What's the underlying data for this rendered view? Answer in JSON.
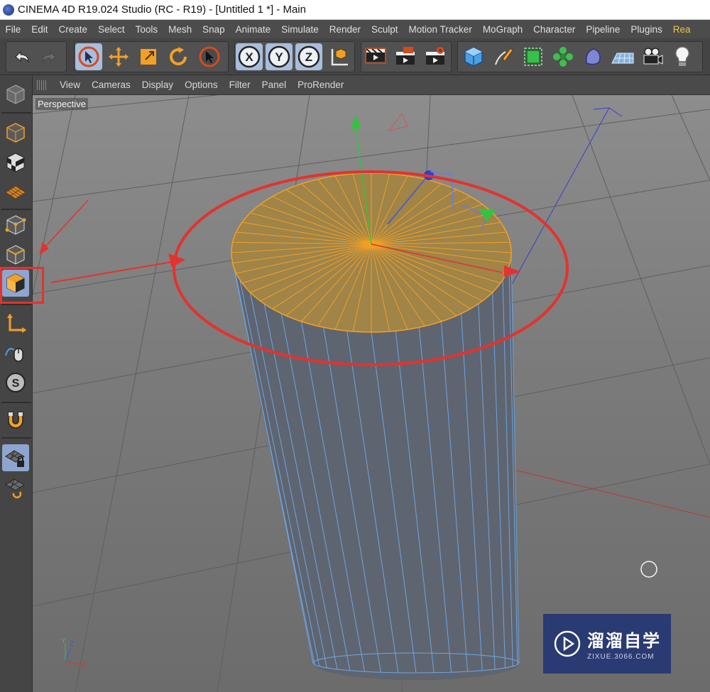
{
  "window": {
    "title": "CINEMA 4D R19.024 Studio (RC - R19) - [Untitled 1 *] - Main"
  },
  "menu": [
    "File",
    "Edit",
    "Create",
    "Select",
    "Tools",
    "Mesh",
    "Snap",
    "Animate",
    "Simulate",
    "Render",
    "Sculpt",
    "Motion Tracker",
    "MoGraph",
    "Character",
    "Pipeline",
    "Plugins",
    "Rea"
  ],
  "toolbar": {
    "icons": [
      "undo-icon",
      "redo-icon",
      "live-selection-icon",
      "move-icon",
      "scale-icon",
      "rotate-icon",
      "recent-tool-icon",
      "x-axis-lock-icon",
      "y-axis-lock-icon",
      "z-axis-lock-icon",
      "coordinate-system-icon",
      "render-view-icon",
      "render-picture-viewer-icon",
      "edit-render-settings-icon",
      "cube-primitive-icon",
      "pen-spline-icon",
      "subdivision-surface-icon",
      "cloner-icon",
      "deformer-icon",
      "floor-icon",
      "camera-icon",
      "light-icon"
    ],
    "axis_labels": {
      "x": "X",
      "y": "Y",
      "z": "Z"
    }
  },
  "left_palette": {
    "icons": [
      "make-editable-icon",
      "model-mode-icon",
      "texture-mode-icon",
      "workplane-mode-icon",
      "points-mode-icon",
      "edges-mode-icon",
      "polygons-mode-icon",
      "enable-axis-icon",
      "tweak-mode-icon",
      "solo-icon",
      "snap-icon",
      "locked-workplane-icon",
      "planar-workplane-icon"
    ],
    "active": "polygons-mode-icon",
    "solo_label": "S"
  },
  "viewport": {
    "menu": [
      "View",
      "Cameras",
      "Display",
      "Options",
      "Filter",
      "Panel",
      "ProRender"
    ],
    "camera_label": "Perspective",
    "axis_labels": {
      "x": "X",
      "y": "Y",
      "z": "Z"
    },
    "annotation_color": "#e2332e",
    "selection_color": "#f2a025",
    "wireframe_color": "#6fa6e0"
  },
  "watermark": {
    "cn": "溜溜自学",
    "en": "ZIXUE.3066.COM"
  }
}
